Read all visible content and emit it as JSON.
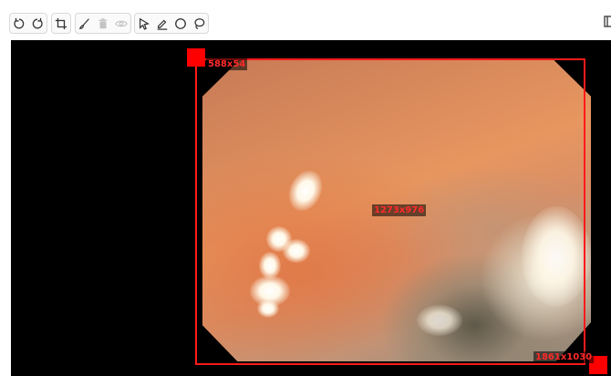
{
  "toolbar": {
    "groups": [
      {
        "name": "rotate",
        "tools": [
          "rotate-left-icon",
          "rotate-right-icon"
        ]
      },
      {
        "name": "crop",
        "tools": [
          "crop-icon"
        ]
      },
      {
        "name": "edit",
        "tools": [
          "brush-icon",
          "trash-icon",
          "eye-icon"
        ],
        "disabled": true
      },
      {
        "name": "draw",
        "tools": [
          "pointer-icon",
          "pen-icon",
          "circle-icon",
          "lasso-icon"
        ]
      }
    ]
  },
  "annotation": {
    "top_left_label": "588x54",
    "center_label": "1273x976",
    "bottom_right_label": "1861x1030",
    "color": "#ff0000"
  }
}
